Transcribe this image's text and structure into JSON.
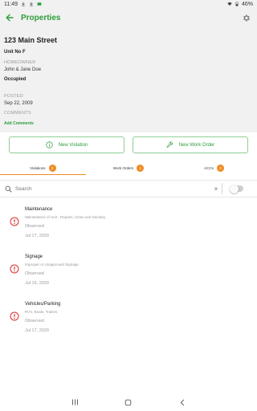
{
  "status_bar": {
    "time": "11:49",
    "battery": "46%"
  },
  "app_bar": {
    "title": "Properties",
    "back_icon": "arrow-back-icon",
    "settings_icon": "gear-icon"
  },
  "property": {
    "address": "123 Main Street",
    "unit": "Unit No F",
    "homeowner_label": "HOMEOWNER",
    "homeowner": "John & Jane Doe",
    "occupancy": "Occupied",
    "posted_label": "POSTED",
    "posted_date": "Sep 22, 2009",
    "comments_label": "COMMENTS",
    "add_comments": "Add Comments"
  },
  "actions": {
    "new_violation": "New Violation",
    "new_work_order": "New Work Order"
  },
  "tabs": [
    {
      "label": "Violations",
      "count": "3",
      "active": true
    },
    {
      "label": "Work Orders",
      "count": "1",
      "active": false
    },
    {
      "label": "ACCs",
      "count": "0",
      "active": false
    }
  ],
  "search": {
    "placeholder": "Search",
    "clear": "×"
  },
  "violations": [
    {
      "title": "Maintenance",
      "description": "Maintenance of Unit - Repairs, Clean and Sanitary",
      "status": "Observed",
      "date": "Jul 17, 2020"
    },
    {
      "title": "Signage",
      "description": "Improper or Unapproved Signage",
      "status": "Observed",
      "date": "Jul 16, 2020"
    },
    {
      "title": "Vehicles/Parking",
      "description": "RV's, Boats, Trailers",
      "status": "Observed",
      "date": "Jul 17, 2020"
    }
  ],
  "colors": {
    "accent": "#2e9d3a",
    "tab_indicator": "#f08a24",
    "warning": "#d9302c"
  }
}
